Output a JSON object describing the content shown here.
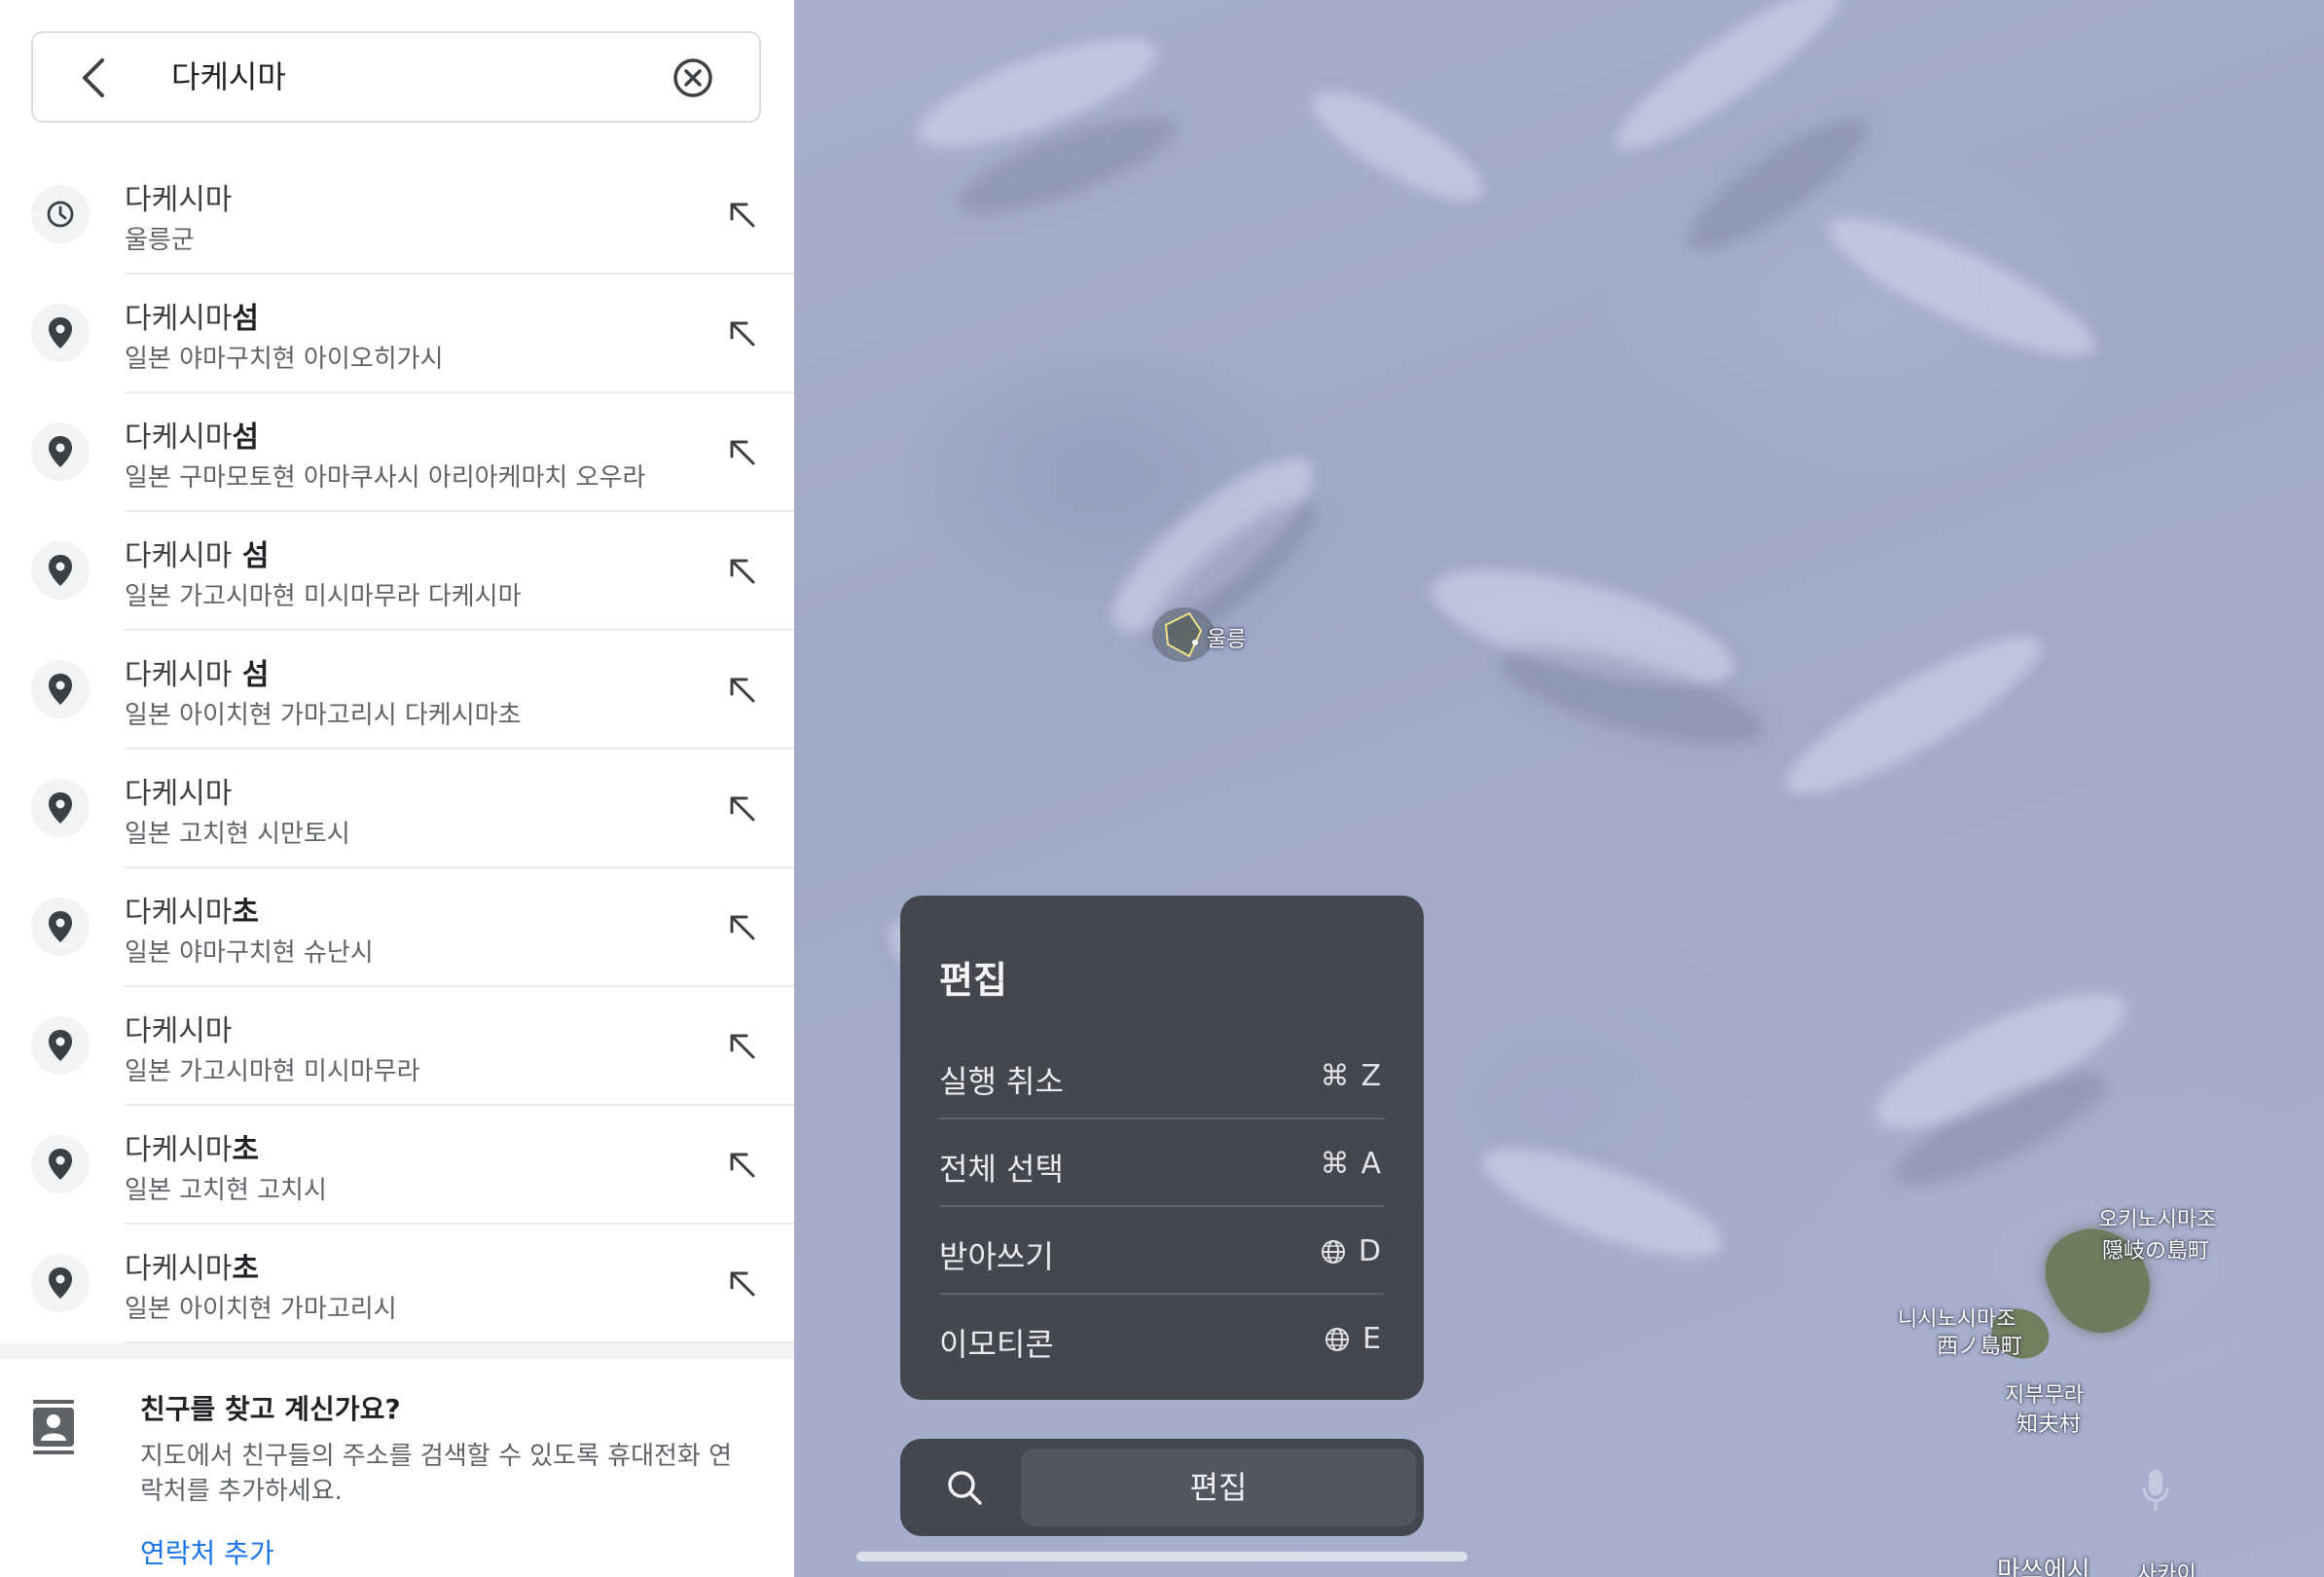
{
  "search": {
    "query": "다케시마"
  },
  "results": [
    {
      "icon": "clock-icon",
      "title_match": "다케시마",
      "title_rest": "",
      "subtitle": "울릉군"
    },
    {
      "icon": "place-pin-icon",
      "title_match": "다케시마",
      "title_rest": "섬",
      "subtitle": "일본 야마구치현 아이오히가시"
    },
    {
      "icon": "place-pin-icon",
      "title_match": "다케시마",
      "title_rest": "섬",
      "subtitle": "일본 구마모토현 아마쿠사시 아리아케마치 오우라"
    },
    {
      "icon": "place-pin-icon",
      "title_match": "다케시마",
      "title_rest": " 섬",
      "subtitle": "일본 가고시마현 미시마무라 다케시마"
    },
    {
      "icon": "place-pin-icon",
      "title_match": "다케시마",
      "title_rest": " 섬",
      "subtitle": "일본 아이치현 가마고리시 다케시마초"
    },
    {
      "icon": "place-pin-icon",
      "title_match": "다케시마",
      "title_rest": "",
      "subtitle": "일본 고치현 시만토시"
    },
    {
      "icon": "place-pin-icon",
      "title_match": "다케시마",
      "title_rest": "초",
      "subtitle": "일본 야마구치현 슈난시"
    },
    {
      "icon": "place-pin-icon",
      "title_match": "다케시마",
      "title_rest": "",
      "subtitle": "일본 가고시마현 미시마무라"
    },
    {
      "icon": "place-pin-icon",
      "title_match": "다케시마",
      "title_rest": "초",
      "subtitle": "일본 고치현 고치시"
    },
    {
      "icon": "place-pin-icon",
      "title_match": "다케시마",
      "title_rest": "초",
      "subtitle": "일본 아이치현 가마고리시"
    }
  ],
  "friends": {
    "heading": "친구를 찾고 계신가요?",
    "body": "지도에서 친구들의 주소를 검색할 수 있도록 휴대전화 연락처를 추가하세요.",
    "link": "연락처 추가"
  },
  "map": {
    "labels": {
      "ulleung": "울릉",
      "okinoshima_ko": "오키노시마조",
      "okinoshima_ja": "隠岐の島町",
      "nishinoshima_ko": "니시노시마조",
      "nishinoshima_ja": "西ノ島町",
      "chibu_ko": "지부무라",
      "chibu_ja": "知夫村",
      "matsue_ko": "마쓰에시",
      "sakai_ko": "사카이"
    }
  },
  "edit_menu": {
    "title": "편집",
    "items": [
      {
        "label": "실행 취소",
        "modifier": "⌘",
        "key": "Z",
        "modifier_icon": "command-key-icon"
      },
      {
        "label": "전체 선택",
        "modifier": "⌘",
        "key": "A",
        "modifier_icon": "command-key-icon"
      },
      {
        "label": "받아쓰기",
        "modifier": "",
        "key": "D",
        "modifier_icon": "globe-icon"
      },
      {
        "label": "이모티콘",
        "modifier": "",
        "key": "E",
        "modifier_icon": "globe-icon"
      }
    ]
  },
  "bottom_bar": {
    "button_label": "편집"
  },
  "colors": {
    "link": "#1a73e8",
    "menu_bg": "#45474f",
    "icon_gray": "#3c4043"
  }
}
